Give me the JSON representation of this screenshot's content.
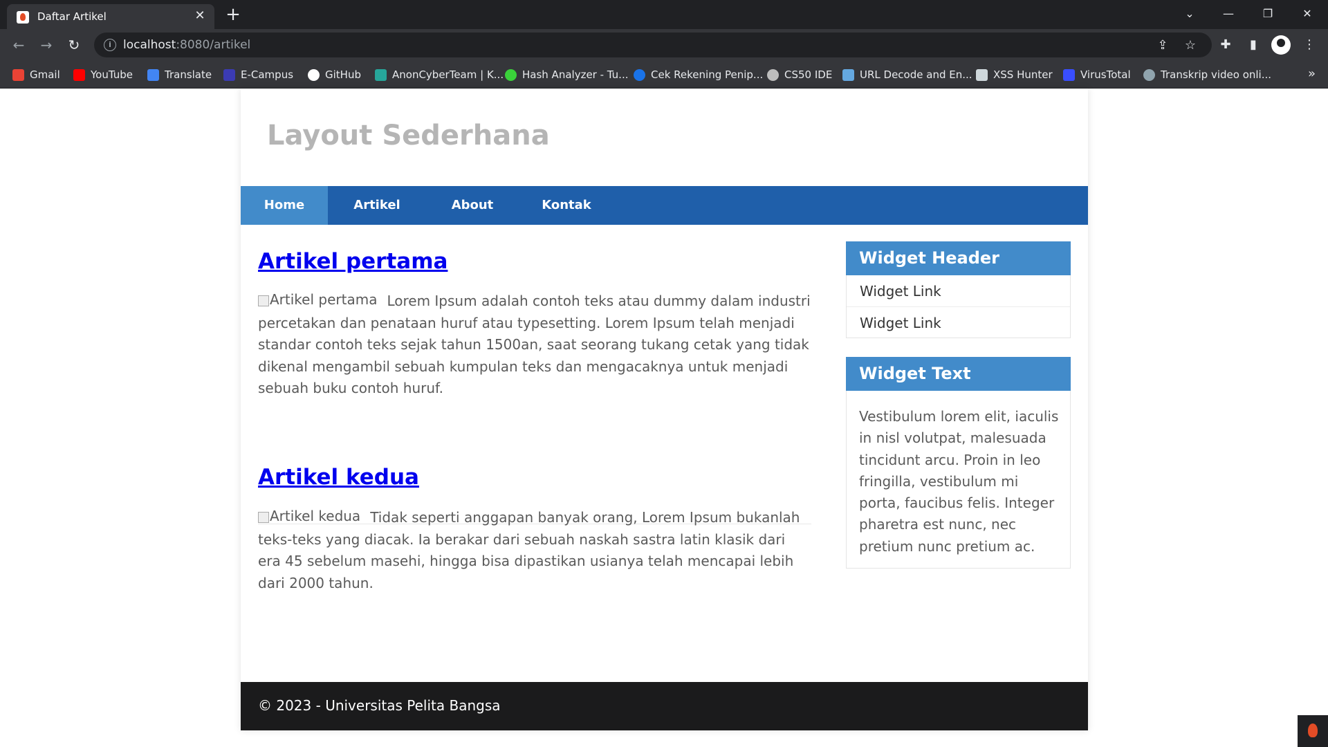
{
  "browser": {
    "tab_title": "Daftar Artikel",
    "tab_close": "✕",
    "new_tab": "+",
    "url_host": "localhost",
    "url_path": ":8080/artikel",
    "window_controls": {
      "dropdown": "⌄",
      "minimize": "—",
      "restore": "❐",
      "close": "✕"
    },
    "nav": {
      "back": "←",
      "forward": "→",
      "reload": "↻"
    },
    "toolbar_icons": {
      "share": "⇪",
      "star": "☆",
      "extensions": "✚",
      "sidepanel": "▮",
      "menu": "⋮"
    },
    "bookmarks": [
      {
        "label": "Gmail",
        "icon": "gmail-icon",
        "color": "#ea4335"
      },
      {
        "label": "YouTube",
        "icon": "youtube-icon",
        "color": "#ff0000"
      },
      {
        "label": "Translate",
        "icon": "translate-icon",
        "color": "#4285f4"
      },
      {
        "label": "E-Campus",
        "icon": "ecampus-icon",
        "color": "#3b3bb3"
      },
      {
        "label": "GitHub",
        "icon": "github-icon",
        "color": "#ffffff"
      },
      {
        "label": "AnonCyberTeam | K...",
        "icon": "anoncyberteam-icon",
        "color": "#26a69a"
      },
      {
        "label": "Hash Analyzer - Tu...",
        "icon": "hash-analyzer-icon",
        "color": "#3ad13a"
      },
      {
        "label": "Cek Rekening Penip...",
        "icon": "cek-rekening-icon",
        "color": "#1a73e8"
      },
      {
        "label": "CS50 IDE",
        "icon": "cs50-icon",
        "color": "#bdbdbd"
      },
      {
        "label": "URL Decode and En...",
        "icon": "url-decode-icon",
        "color": "#64a8e0"
      },
      {
        "label": "XSS Hunter",
        "icon": "xss-hunter-icon",
        "color": "#cfd8dc"
      },
      {
        "label": "VirusTotal",
        "icon": "virustotal-icon",
        "color": "#394eff"
      },
      {
        "label": "Transkrip video onli...",
        "icon": "transkrip-icon",
        "color": "#90a4ae"
      }
    ],
    "bookmarks_more": "»"
  },
  "site": {
    "title": "Layout Sederhana",
    "nav": [
      {
        "label": "Home",
        "active": true
      },
      {
        "label": "Artikel",
        "active": false
      },
      {
        "label": "About",
        "active": false
      },
      {
        "label": "Kontak",
        "active": false
      }
    ],
    "articles": [
      {
        "title": "Artikel pertama",
        "image_alt": "Artikel pertama",
        "body": "Lorem Ipsum adalah contoh teks atau dummy dalam industri percetakan dan penataan huruf atau typesetting. Lorem Ipsum telah menjadi standar contoh teks sejak tahun 1500an, saat seorang tukang cetak yang tidak dikenal mengambil sebuah kumpulan teks dan mengacaknya untuk menjadi sebuah buku contoh huruf."
      },
      {
        "title": "Artikel kedua",
        "image_alt": "Artikel kedua",
        "body": "Tidak seperti anggapan banyak orang, Lorem Ipsum bukanlah teks-teks yang diacak. Ia berakar dari sebuah naskah sastra latin klasik dari era 45 sebelum masehi, hingga bisa dipastikan usianya telah mencapai lebih dari 2000 tahun."
      }
    ],
    "widgets": {
      "links_header": "Widget Header",
      "links": [
        "Widget Link",
        "Widget Link"
      ],
      "text_header": "Widget Text",
      "text": "Vestibulum lorem elit, iaculis in nisl volutpat, malesuada tincidunt arcu. Proin in leo fringilla, vestibulum mi porta, faucibus felis. Integer pharetra est nunc, nec pretium nunc pretium ac."
    },
    "footer": "© 2023 - Universitas Pelita Bangsa"
  },
  "colors": {
    "nav_bar": "#1f5faa",
    "nav_active": "#428bca",
    "widget_header": "#428bca",
    "footer": "#1b1b1c",
    "link": "#0000ee",
    "site_title": "#b5b5b5"
  }
}
